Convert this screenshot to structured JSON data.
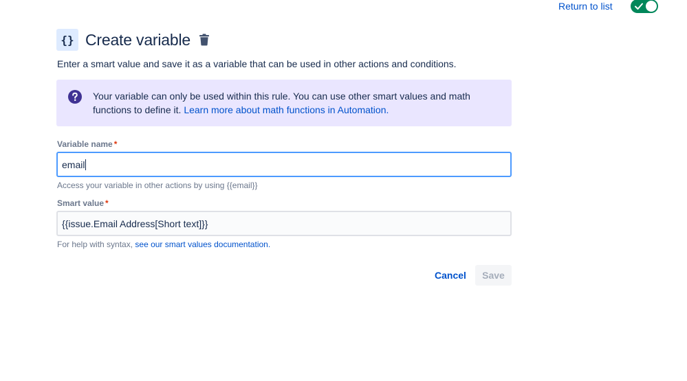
{
  "topbar": {
    "return_link": "Return to list",
    "toggle_state": "on"
  },
  "header": {
    "icon_glyph": "{}",
    "title": "Create variable"
  },
  "subtitle": "Enter a smart value and save it as a variable that can be used in other actions and conditions.",
  "info_panel": {
    "text": "Your variable can only be used within this rule. You can use other smart values and math functions to define it.",
    "link": "Learn more about math functions in Automation."
  },
  "variable_name": {
    "label": "Variable name",
    "required_mark": "*",
    "value": "email",
    "helper": "Access your variable in other actions by using {{email}}"
  },
  "smart_value": {
    "label": "Smart value",
    "required_mark": "*",
    "value": "{{issue.Email Address[Short text]}}",
    "helper_prefix": "For help with syntax,",
    "helper_link": "see our smart values documentation."
  },
  "actions": {
    "cancel": "Cancel",
    "save": "Save"
  },
  "colors": {
    "link": "#0052CC",
    "toggle_on": "#00875A",
    "info_bg": "#EAE6FF",
    "info_icon": "#403294",
    "focus_border": "#4C9AFF",
    "required": "#DE350B"
  }
}
